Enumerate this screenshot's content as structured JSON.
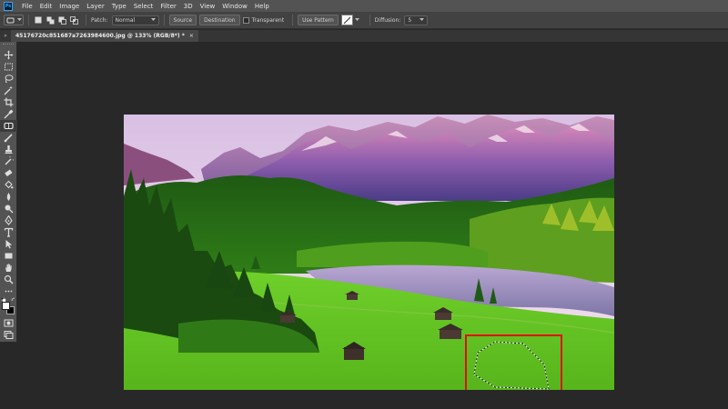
{
  "app": {
    "logo_text": "Ps"
  },
  "menu": [
    "File",
    "Edit",
    "Image",
    "Layer",
    "Type",
    "Select",
    "Filter",
    "3D",
    "View",
    "Window",
    "Help"
  ],
  "options": {
    "patch_label": "Patch:",
    "patch_mode": "Normal",
    "source_label": "Source",
    "destination_label": "Destination",
    "transparent_label": "Transparent",
    "use_pattern_label": "Use Pattern",
    "diffusion_label": "Diffusion:",
    "diffusion_value": "5"
  },
  "document": {
    "tab_title": "45176720c851687a7263984600.jpg @ 133% (RGB/8*) *",
    "close_glyph": "×",
    "collapse_glyph": "»"
  },
  "tools": [
    "move-tool",
    "marquee-tool",
    "lasso-tool",
    "magic-wand-tool",
    "crop-tool",
    "eyedropper-tool",
    "patch-tool",
    "brush-tool",
    "clone-stamp-tool",
    "history-brush-tool",
    "eraser-tool",
    "paint-bucket-tool",
    "blur-tool",
    "dodge-tool",
    "pen-tool",
    "type-tool",
    "path-selection-tool",
    "rectangle-tool",
    "hand-tool",
    "zoom-tool"
  ],
  "colors": {
    "foreground": "#ffffff",
    "background": "#000000",
    "highlight": "#e01010"
  }
}
